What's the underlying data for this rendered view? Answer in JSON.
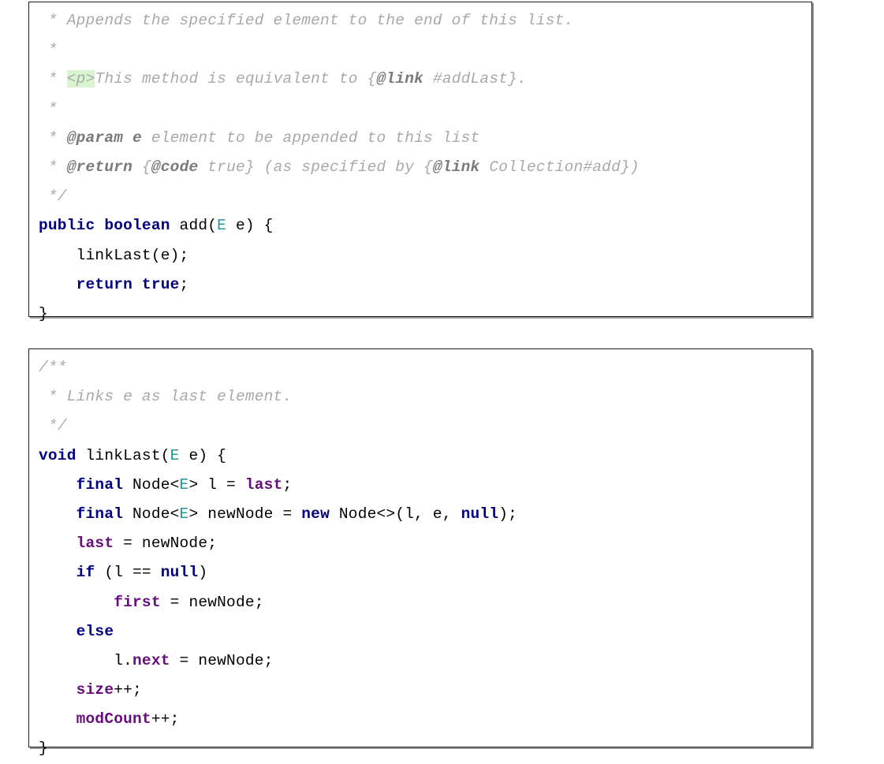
{
  "document": {
    "kind": "java-source-figure",
    "language": "Java",
    "colors": {
      "background": "#ffffff",
      "border": "#1a1a1a",
      "shadow": "#9a9a9a",
      "comment": "#a9a9a9",
      "comment_tag": "#7a7a7a",
      "comment_highlight_background": "#d8f5d0",
      "keyword": "#000080",
      "field": "#660e7a",
      "type_parameter": "#20999d",
      "plain_text": "#000000"
    }
  },
  "blocks": [
    {
      "id": "block-add",
      "name": "add-method-block",
      "lines": [
        {
          "id": "add-l1",
          "text": " * Appends the specified element to the end of this list.",
          "tokens": [
            {
              "t": " * Appends the specified element to the end of this list.",
              "c": "cmt"
            }
          ]
        },
        {
          "id": "add-l2",
          "text": " *",
          "tokens": [
            {
              "t": " *",
              "c": "cmt"
            }
          ]
        },
        {
          "id": "add-l3",
          "text": " * <p>This method is equivalent to {@link #addLast}.",
          "tokens": [
            {
              "t": " * ",
              "c": "cmt"
            },
            {
              "t": "<p>",
              "c": "cmt-hl"
            },
            {
              "t": "This method is equivalent to {",
              "c": "cmt"
            },
            {
              "t": "@link",
              "c": "cmt-tag"
            },
            {
              "t": " #addLast}.",
              "c": "cmt"
            }
          ]
        },
        {
          "id": "add-l4",
          "text": " *",
          "tokens": [
            {
              "t": " *",
              "c": "cmt"
            }
          ]
        },
        {
          "id": "add-l5",
          "text": " * @param e element to be appended to this list",
          "tokens": [
            {
              "t": " * ",
              "c": "cmt"
            },
            {
              "t": "@param",
              "c": "cmt-tag"
            },
            {
              "t": " ",
              "c": "cmt"
            },
            {
              "t": "e",
              "c": "cmt-tag"
            },
            {
              "t": " element to be appended to this list",
              "c": "cmt"
            }
          ]
        },
        {
          "id": "add-l6",
          "text": " * @return {@code true} (as specified by {@link Collection#add})",
          "tokens": [
            {
              "t": " * ",
              "c": "cmt"
            },
            {
              "t": "@return",
              "c": "cmt-tag"
            },
            {
              "t": " {",
              "c": "cmt"
            },
            {
              "t": "@code",
              "c": "cmt-tag"
            },
            {
              "t": " true} (as specified by {",
              "c": "cmt"
            },
            {
              "t": "@link",
              "c": "cmt-tag"
            },
            {
              "t": " Collection#add})",
              "c": "cmt"
            }
          ]
        },
        {
          "id": "add-l7",
          "text": " */",
          "tokens": [
            {
              "t": " */",
              "c": "cmt"
            }
          ]
        },
        {
          "id": "add-l8",
          "text": "public boolean add(E e) {",
          "tokens": [
            {
              "t": "public boolean",
              "c": "kw"
            },
            {
              "t": " add(",
              "c": "plain"
            },
            {
              "t": "E",
              "c": "type-param"
            },
            {
              "t": " e) {",
              "c": "plain"
            }
          ]
        },
        {
          "id": "add-l9",
          "text": "    linkLast(e);",
          "tokens": [
            {
              "t": "    linkLast(e);",
              "c": "plain"
            }
          ]
        },
        {
          "id": "add-l10",
          "text": "    return true;",
          "tokens": [
            {
              "t": "    ",
              "c": "plain"
            },
            {
              "t": "return true",
              "c": "kw"
            },
            {
              "t": ";",
              "c": "plain"
            }
          ]
        },
        {
          "id": "add-l11",
          "text": "}",
          "tokens": [
            {
              "t": "}",
              "c": "plain"
            }
          ]
        }
      ]
    },
    {
      "id": "block-link",
      "name": "linklast-method-block",
      "lines": [
        {
          "id": "link-l1",
          "text": "/**",
          "tokens": [
            {
              "t": "/**",
              "c": "cmt"
            }
          ]
        },
        {
          "id": "link-l2",
          "text": " * Links e as last element.",
          "tokens": [
            {
              "t": " * Links e as last element.",
              "c": "cmt"
            }
          ]
        },
        {
          "id": "link-l3",
          "text": " */",
          "tokens": [
            {
              "t": " */",
              "c": "cmt"
            }
          ]
        },
        {
          "id": "link-l4",
          "text": "void linkLast(E e) {",
          "tokens": [
            {
              "t": "void",
              "c": "kw"
            },
            {
              "t": " linkLast(",
              "c": "plain"
            },
            {
              "t": "E",
              "c": "type-param"
            },
            {
              "t": " e) {",
              "c": "plain"
            }
          ]
        },
        {
          "id": "link-l5",
          "text": "    final Node<E> l = last;",
          "tokens": [
            {
              "t": "    ",
              "c": "plain"
            },
            {
              "t": "final",
              "c": "kw"
            },
            {
              "t": " Node<",
              "c": "plain"
            },
            {
              "t": "E",
              "c": "type-param"
            },
            {
              "t": "> l = ",
              "c": "plain"
            },
            {
              "t": "last",
              "c": "field"
            },
            {
              "t": ";",
              "c": "plain"
            }
          ]
        },
        {
          "id": "link-l6",
          "text": "    final Node<E> newNode = new Node<>(l, e, null);",
          "tokens": [
            {
              "t": "    ",
              "c": "plain"
            },
            {
              "t": "final",
              "c": "kw"
            },
            {
              "t": " Node<",
              "c": "plain"
            },
            {
              "t": "E",
              "c": "type-param"
            },
            {
              "t": "> newNode = ",
              "c": "plain"
            },
            {
              "t": "new",
              "c": "kw"
            },
            {
              "t": " Node<>(l, e, ",
              "c": "plain"
            },
            {
              "t": "null",
              "c": "kw"
            },
            {
              "t": ");",
              "c": "plain"
            }
          ]
        },
        {
          "id": "link-l7",
          "text": "    last = newNode;",
          "tokens": [
            {
              "t": "    ",
              "c": "plain"
            },
            {
              "t": "last",
              "c": "field"
            },
            {
              "t": " = newNode;",
              "c": "plain"
            }
          ]
        },
        {
          "id": "link-l8",
          "text": "    if (l == null)",
          "tokens": [
            {
              "t": "    ",
              "c": "plain"
            },
            {
              "t": "if",
              "c": "kw"
            },
            {
              "t": " (l == ",
              "c": "plain"
            },
            {
              "t": "null",
              "c": "kw"
            },
            {
              "t": ")",
              "c": "plain"
            }
          ]
        },
        {
          "id": "link-l9",
          "text": "        first = newNode;",
          "tokens": [
            {
              "t": "        ",
              "c": "plain"
            },
            {
              "t": "first",
              "c": "field"
            },
            {
              "t": " = newNode;",
              "c": "plain"
            }
          ]
        },
        {
          "id": "link-l10",
          "text": "    else",
          "tokens": [
            {
              "t": "    ",
              "c": "plain"
            },
            {
              "t": "else",
              "c": "kw"
            }
          ]
        },
        {
          "id": "link-l11",
          "text": "        l.next = newNode;",
          "tokens": [
            {
              "t": "        l.",
              "c": "plain"
            },
            {
              "t": "next",
              "c": "field"
            },
            {
              "t": " = newNode;",
              "c": "plain"
            }
          ]
        },
        {
          "id": "link-l12",
          "text": "    size++;",
          "tokens": [
            {
              "t": "    ",
              "c": "plain"
            },
            {
              "t": "size",
              "c": "field"
            },
            {
              "t": "++;",
              "c": "plain"
            }
          ]
        },
        {
          "id": "link-l13",
          "text": "    modCount++;",
          "tokens": [
            {
              "t": "    ",
              "c": "plain"
            },
            {
              "t": "modCount",
              "c": "field"
            },
            {
              "t": "++;",
              "c": "plain"
            }
          ]
        },
        {
          "id": "link-l14",
          "text": "}",
          "tokens": [
            {
              "t": "}",
              "c": "plain"
            }
          ]
        }
      ]
    }
  ]
}
